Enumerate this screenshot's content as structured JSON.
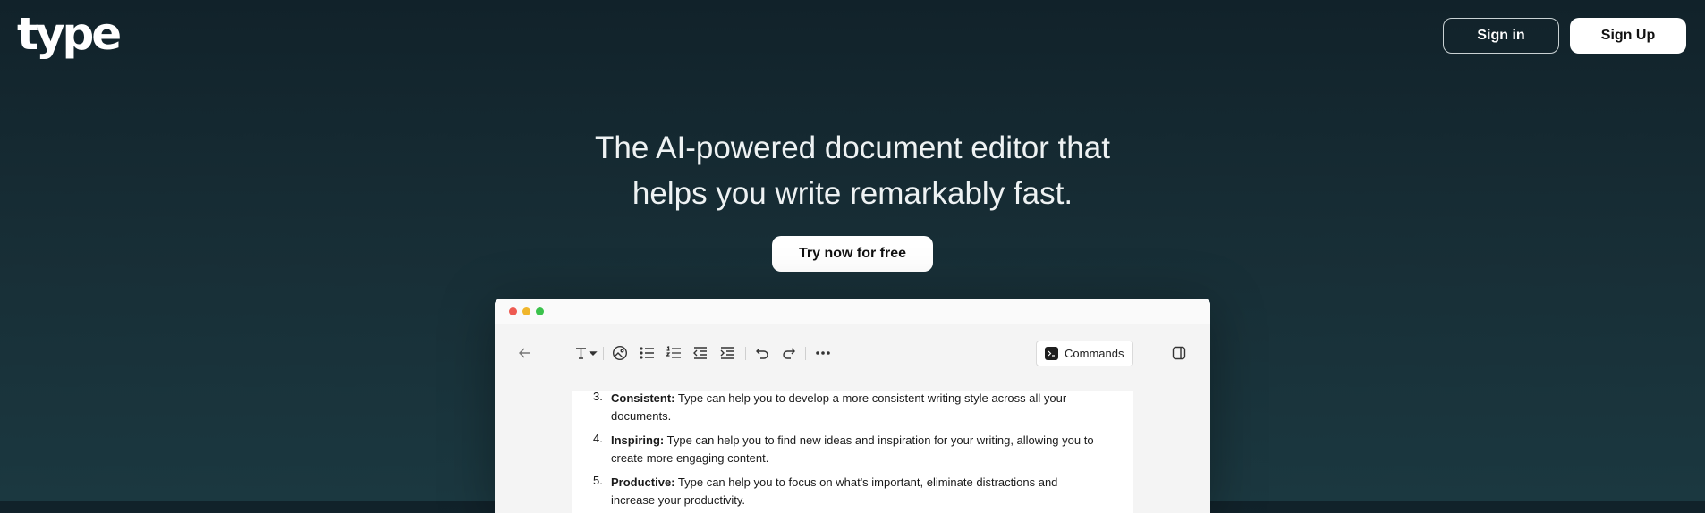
{
  "header": {
    "logo": "type",
    "sign_in": "Sign in",
    "sign_up": "Sign Up"
  },
  "hero": {
    "line1": "The AI-powered document editor that",
    "line2": "helps you write remarkably fast.",
    "cta": "Try now for free"
  },
  "editor": {
    "commands_label": "Commands",
    "toolbar_icons": [
      "back-arrow-icon",
      "text-style-icon",
      "image-icon",
      "bullet-list-icon",
      "numbered-list-icon",
      "outdent-icon",
      "indent-icon",
      "undo-icon",
      "redo-icon",
      "more-icon",
      "sidebar-toggle-icon"
    ],
    "items": [
      {
        "num": "3.",
        "title": "Consistent:",
        "text": "Type can help you to develop a more consistent writing style across all your documents."
      },
      {
        "num": "4.",
        "title": "Inspiring:",
        "text": "Type can help you to find new ideas and inspiration for your writing, allowing you to create more engaging content."
      },
      {
        "num": "5.",
        "title": "Productive:",
        "text": "Type can help you to focus on what's important, eliminate distractions and increase your productivity."
      }
    ]
  },
  "colors": {
    "background": "#13262d",
    "window_dot_red": "#ee5a51",
    "window_dot_yellow": "#f0b62c",
    "window_dot_green": "#3bc24c"
  }
}
